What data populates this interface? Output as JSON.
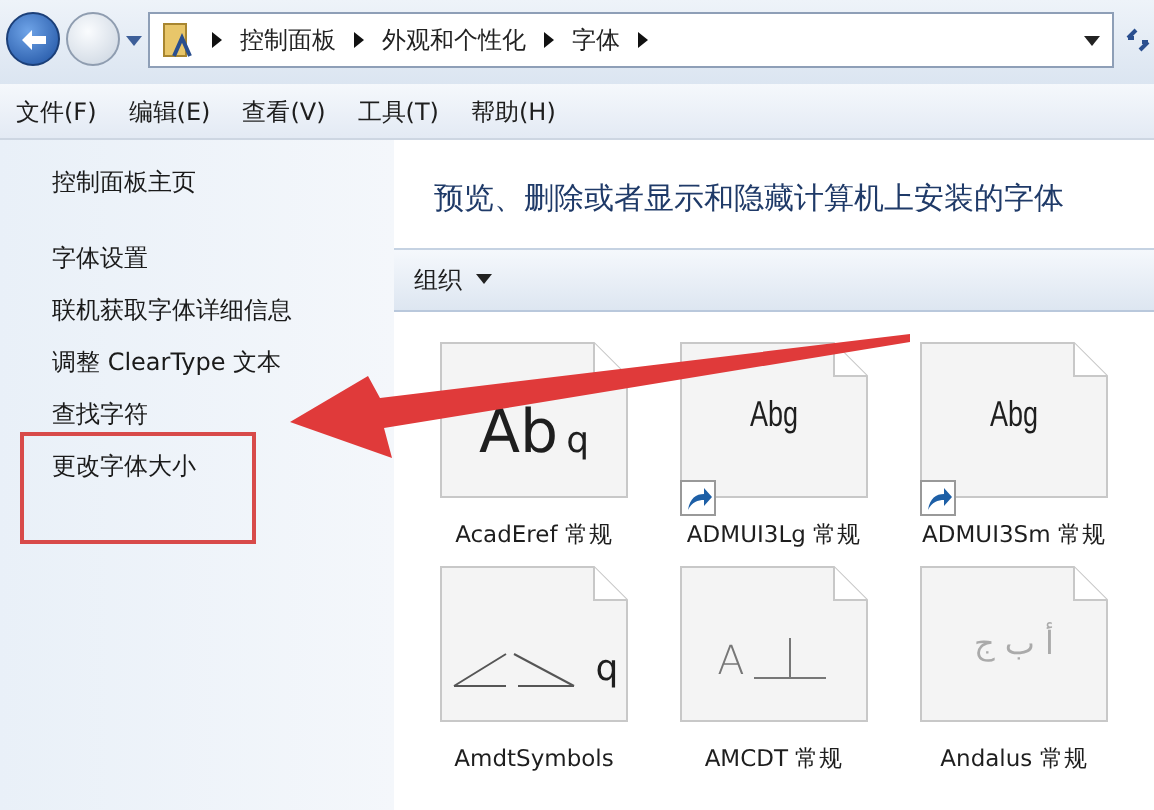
{
  "address_bar": {
    "breadcrumb": [
      "控制面板",
      "外观和个性化",
      "字体"
    ]
  },
  "menu": [
    "文件(F)",
    "编辑(E)",
    "查看(V)",
    "工具(T)",
    "帮助(H)"
  ],
  "sidebar": {
    "items": [
      {
        "label": "控制面板主页",
        "kind": "home",
        "boxed": false
      },
      {
        "label": "字体设置",
        "kind": "task",
        "boxed": false
      },
      {
        "label": "联机获取字体详细信息",
        "kind": "task",
        "boxed": false
      },
      {
        "label": "调整 ClearType 文本",
        "kind": "task",
        "boxed": false
      },
      {
        "label": "查找字符",
        "kind": "task",
        "boxed": false
      },
      {
        "label": "更改字体大小",
        "kind": "task",
        "boxed": true
      }
    ]
  },
  "content": {
    "heading": "预览、删除或者显示和隐藏计算机上安装的字体",
    "toolbar": {
      "organize": "组织"
    }
  },
  "fonts": [
    {
      "name": "AcadEref 常规",
      "kind": "large",
      "preview": "Ab",
      "preview_small": "q",
      "shortcut": false
    },
    {
      "name": "ADMUI3Lg 常规",
      "kind": "narrow",
      "preview": "Abg",
      "shortcut": true
    },
    {
      "name": "ADMUI3Sm 常规",
      "kind": "narrow",
      "preview": "Abg",
      "shortcut": true
    },
    {
      "name": "AmdtSymbols",
      "kind": "symbols",
      "preview": "q",
      "shortcut": false
    },
    {
      "name": "AMCDT 常规",
      "kind": "gdt",
      "preview": "A",
      "shortcut": false
    },
    {
      "name": "Andalus 常规",
      "kind": "faded",
      "preview": "أ ب ج",
      "shortcut": false
    }
  ],
  "annotation": {
    "arrow": true
  }
}
